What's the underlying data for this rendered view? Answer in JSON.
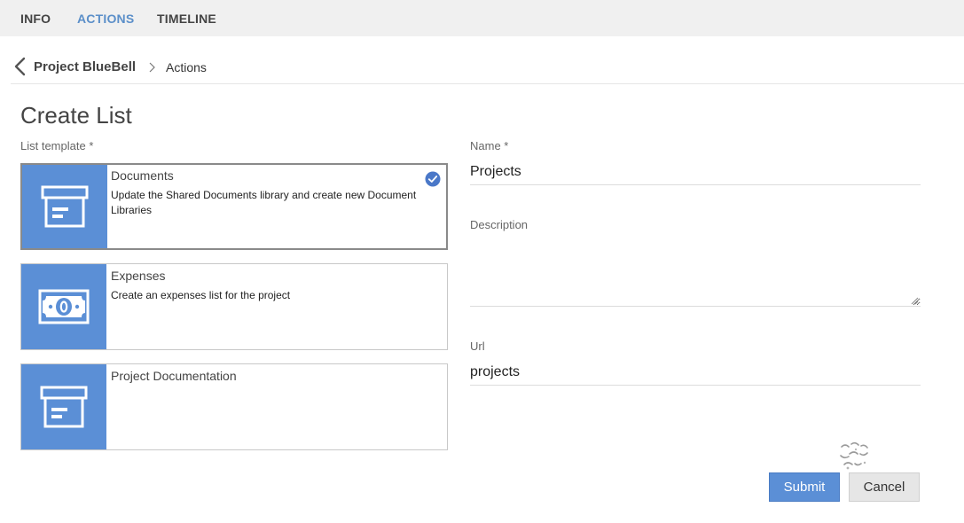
{
  "nav": {
    "tabs": [
      {
        "label": "INFO",
        "active": false
      },
      {
        "label": "ACTIONS",
        "active": true
      },
      {
        "label": "TIMELINE",
        "active": false
      }
    ]
  },
  "breadcrumb": {
    "root": "Project BlueBell",
    "current": "Actions"
  },
  "page": {
    "title": "Create List"
  },
  "form": {
    "template_label": "List template *",
    "templates": [
      {
        "title": "Documents",
        "description": "Update the Shared Documents library and create new Document Libraries",
        "icon": "archive-box-icon",
        "selected": true
      },
      {
        "title": "Expenses",
        "description": "Create an expenses list for the project",
        "icon": "banknote-icon",
        "selected": false
      },
      {
        "title": "Project Documentation",
        "description": "",
        "icon": "archive-box-icon",
        "selected": false
      }
    ],
    "name_label": "Name *",
    "name_value": "Projects",
    "description_label": "Description",
    "description_value": "",
    "url_label": "Url",
    "url_value": "projects",
    "submit_label": "Submit",
    "cancel_label": "Cancel"
  },
  "colors": {
    "accent": "#5b8fd6",
    "active_tab": "#5b8fc9",
    "nav_background": "#f0f0f0"
  }
}
